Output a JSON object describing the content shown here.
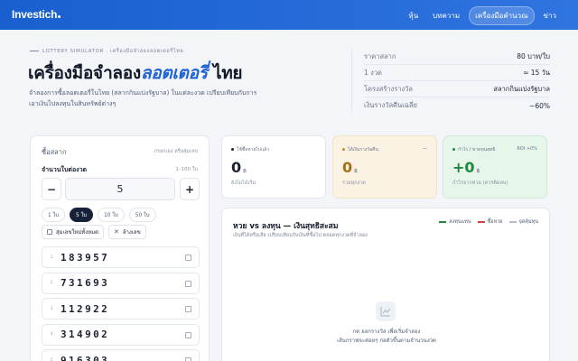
{
  "header": {
    "logo": "Investich",
    "nav": [
      {
        "label": "หุ้น"
      },
      {
        "label": "บทความ"
      },
      {
        "label": "เครื่องมือคำนวณ",
        "active": true
      },
      {
        "label": "ข่าว"
      }
    ]
  },
  "hero": {
    "eyebrow": "LOTTERY SIMULATOR · เครื่องมือจำลองลอตเตอรี่ไทย",
    "title_prefix": "เครื่องมือจำลอง",
    "title_accent": "ลอตเตอรี่",
    "title_suffix": " ไทย",
    "description": "จำลองการซื้อลอตเตอรี่ในไทย (สลากกินแบ่งรัฐบาล) ในแต่ละงวด เปรียบเทียบกับการเอาเงินไปลงทุนในสินทรัพย์ต่างๆ"
  },
  "info_table": [
    {
      "label": "ราคาสลาก",
      "value": "80 บาท/ใบ"
    },
    {
      "label": "1 งวด",
      "value": "≈ 15 วัน"
    },
    {
      "label": "โครงสร้างรางวัล",
      "value": "สลากกินแบ่งรัฐบาล"
    },
    {
      "label": "เงินรางวัลคืนเฉลี่ย",
      "value": "~60%"
    }
  ],
  "ticket_panel": {
    "heading": "ซื้อสลาก",
    "hint": "กรอกเอง หรือสุ่มเลข",
    "qty_label": "จำนวนใบต่องวด",
    "qty_range": "1–100 ใบ",
    "minus": "−",
    "plus": "+",
    "qty_value": "5",
    "chips": [
      {
        "label": "1 ใบ",
        "active": false
      },
      {
        "label": "5 ใบ",
        "active": true
      },
      {
        "label": "10 ใบ",
        "active": false
      },
      {
        "label": "50 ใบ",
        "active": false
      }
    ],
    "random_all": "สุ่มเลขใหม่ทั้งหมด",
    "clear": "ล้างเลข",
    "tickets": [
      {
        "idx": "1",
        "number": "183957"
      },
      {
        "idx": "2",
        "number": "731693"
      },
      {
        "idx": "3",
        "number": "112922"
      },
      {
        "idx": "4",
        "number": "314902"
      },
      {
        "idx": "5",
        "number": "916303"
      }
    ]
  },
  "stats": {
    "spend": {
      "label": "ใช้ซื้อหวยไปแล้ว",
      "value": "0",
      "unit": "฿",
      "sub": "ยังไม่ได้เริ่ม",
      "dot": "#1b2333"
    },
    "win": {
      "label": "ได้เงินรางวัลคืน",
      "value": "0",
      "unit": "฿",
      "sub": "รวมทุกงวด",
      "right": "—",
      "dot": "#c7892a"
    },
    "profit": {
      "label": "กำไร / ขาดทุนสุทธิ",
      "value": "+0",
      "unit": "฿",
      "sub": "กำไรจากหวย (ควรติดลบ)",
      "right": "ROI +0%",
      "dot": "#1e8a3e"
    }
  },
  "chart": {
    "title": "หวย vs ลงทุน — เงินสุทธิสะสม",
    "subtitle": "เงินที่ได้หรือเสีย เปรียบเทียบกับเงินที่ซื้อไป ตลอดทุกงวดที่จำลอง",
    "legend": [
      {
        "label": "ลงทุนแทน",
        "color": "#1e8a3e"
      },
      {
        "label": "ซื้อหวย",
        "color": "#d0453b"
      },
      {
        "label": "จุดคุ้มทุน",
        "color": "#b7bdca"
      }
    ],
    "empty_line1": "กด ออกรางวัล เพื่อเริ่มจำลอง",
    "empty_line2": "เส้นกราฟจะค่อยๆ ก่อตัวขึ้นตามจำนวนงวด"
  },
  "chart_data": {
    "type": "line",
    "title": "หวย vs ลงทุน — เงินสุทธิสะสม",
    "series": [
      {
        "name": "ลงทุนแทน",
        "values": []
      },
      {
        "name": "ซื้อหวย",
        "values": []
      },
      {
        "name": "จุดคุ้มทุน",
        "values": []
      }
    ]
  }
}
